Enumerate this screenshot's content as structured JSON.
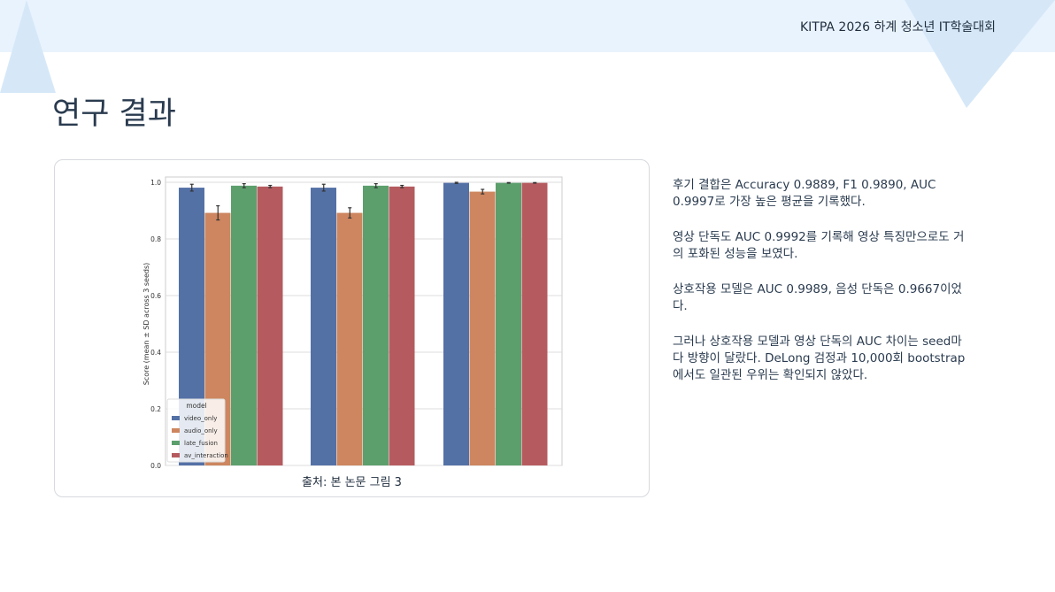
{
  "header": {
    "event": "KITPA 2026 하계 청소년 IT학술대회"
  },
  "slide": {
    "title": "연구 결과"
  },
  "figure": {
    "caption": "출처: 본 논문 그림 3"
  },
  "bullets": [
    "후기 결합은 Accuracy 0.9889, F1 0.9890, AUC 0.9997로 가장 높은 평균을 기록했다.",
    "영상 단독도 AUC 0.9992를 기록해 영상 특징만으로도 거의 포화된 성능을 보였다.",
    "상호작용 모델은 AUC 0.9989, 음성 단독은 0.9667이었다.",
    "그러나 상호작용 모델과 영상 단독의 AUC 차이는 seed마다 방향이 달랐다. DeLong 검정과 10,000회 bootstrap에서도 일관된 우위는 확인되지 않았다."
  ],
  "colors": {
    "accent_band": "#e9f3fd",
    "deco_triangle": "#d6e8f8",
    "video_only": "#5471a6",
    "audio_only": "#cd865f",
    "late_fusion": "#5c9f6d",
    "av_interaction": "#b55b5f"
  },
  "chart_data": {
    "type": "bar",
    "title": "",
    "xlabel": "",
    "ylabel": "Score (mean ± SD across 3 seeds)",
    "ylim": [
      0,
      1.0
    ],
    "yticks": [
      "0.0",
      "0.2",
      "0.4",
      "0.6",
      "0.8",
      "1.0"
    ],
    "categories": [
      "",
      "",
      ""
    ],
    "grid": true,
    "legend_title": "model",
    "legend_position": "lower-left",
    "series": [
      {
        "name": "video_only",
        "values": [
          0.981,
          0.981,
          0.998
        ],
        "errors": [
          0.012,
          0.012,
          0.002
        ]
      },
      {
        "name": "audio_only",
        "values": [
          0.892,
          0.892,
          0.967
        ],
        "errors": [
          0.025,
          0.018,
          0.008
        ]
      },
      {
        "name": "late_fusion",
        "values": [
          0.988,
          0.988,
          0.998
        ],
        "errors": [
          0.007,
          0.007,
          0.001
        ]
      },
      {
        "name": "av_interaction",
        "values": [
          0.985,
          0.985,
          0.998
        ],
        "errors": [
          0.004,
          0.004,
          0.001
        ]
      }
    ]
  }
}
